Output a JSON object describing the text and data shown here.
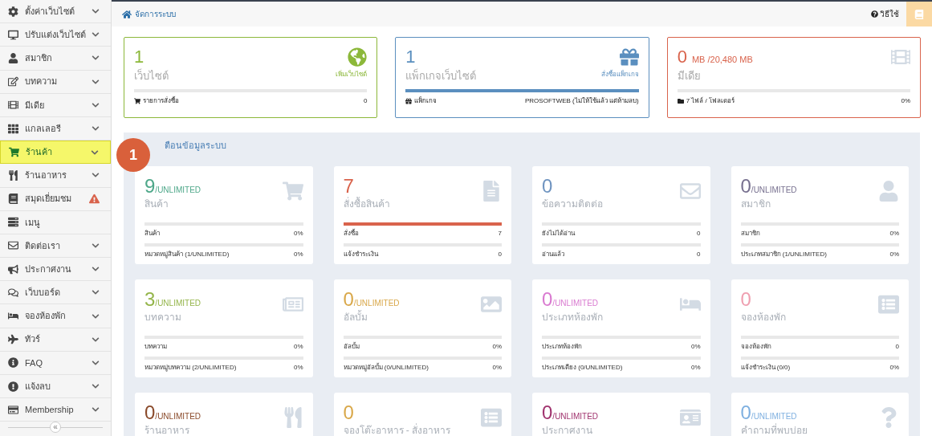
{
  "sidebar": {
    "items": [
      {
        "label": "ตั้งค่าเว็บไซต์",
        "selected": false,
        "kind": "chevron"
      },
      {
        "label": "ปรับแต่งเว็บไซต์",
        "selected": false,
        "kind": "chevron"
      },
      {
        "label": "สมาชิก",
        "selected": false,
        "kind": "chevron"
      },
      {
        "label": "บทความ",
        "selected": false,
        "kind": "chevron"
      },
      {
        "label": "มีเดีย",
        "selected": false,
        "kind": "chevron"
      },
      {
        "label": "แกลเลอรี",
        "selected": false,
        "kind": "chevron"
      },
      {
        "label": "ร้านค้า",
        "selected": true,
        "kind": "chevron"
      },
      {
        "label": "ร้านอาหาร",
        "selected": false,
        "kind": "chevron"
      },
      {
        "label": "สมุดเยี่ยมชม",
        "selected": false,
        "kind": "warning"
      },
      {
        "label": "เมนู",
        "selected": false,
        "kind": "plain"
      },
      {
        "label": "ติดต่อเรา",
        "selected": false,
        "kind": "chevron"
      },
      {
        "label": "ประกาศงาน",
        "selected": false,
        "kind": "chevron"
      },
      {
        "label": "เว็บบอร์ด",
        "selected": false,
        "kind": "chevron"
      },
      {
        "label": "จองห้องพัก",
        "selected": false,
        "kind": "chevron"
      },
      {
        "label": "ทัวร์",
        "selected": false,
        "kind": "chevron"
      },
      {
        "label": "FAQ",
        "selected": false,
        "kind": "chevron"
      },
      {
        "label": "แจ้งลบ",
        "selected": false,
        "kind": "chevron"
      },
      {
        "label": "Membership",
        "selected": false,
        "kind": "chevron"
      }
    ],
    "collapse": "«"
  },
  "header": {
    "breadcrumb": "จัดการระบบ",
    "help": "วิธีใช้"
  },
  "badge": "1",
  "summary_cards": [
    {
      "number": "1",
      "title": "เว็บไซต์",
      "link": "เพิ่มเว็บไซต์",
      "color": "#8cb83a",
      "level": 0,
      "footer_label": "รายการสั่งซื้อ",
      "footer_value": "0"
    },
    {
      "number": "1",
      "title": "แพ็กเกจเว็บไซต์",
      "link": "สั่งซื้อแพ็กเกจ",
      "color": "#5b8fbf",
      "level": 1,
      "footer_label": "แพ็กเกจ",
      "footer_value": "PROSOFTWEB (ไม่ให้ใช้แล้ว แต่ห้ามลบ)"
    },
    {
      "number": "0",
      "unit": "MB  /20,480 MB",
      "title": "มีเดีย",
      "color": "#d9634c",
      "level": 0,
      "footer_label": "7 ไฟล์ / โฟลเดอร์",
      "footer_value": "0%"
    }
  ],
  "section": {
    "title": "ตือนข้อมูลระบบ"
  },
  "stat_cards": [
    {
      "number": "9",
      "unit": "/UNLIMITED",
      "title": "สินค้า",
      "color": "#4fa88a",
      "rows": [
        {
          "label": "สินค้า",
          "value": "0%",
          "level": 0
        },
        {
          "label": "หมวดหมู่สินค้า (1/UNLIMITED)",
          "value": "0%",
          "level": 0
        }
      ]
    },
    {
      "number": "7",
      "title": "สั่งซื้อสินค้า",
      "color": "#d9634c",
      "rows": [
        {
          "label": "สั่งซื้อ",
          "value": "7",
          "level": 1
        },
        {
          "label": "แจ้งชำระเงิน",
          "value": "0",
          "level": 0
        }
      ]
    },
    {
      "number": "0",
      "title": "ข้อความติดต่อ",
      "color": "#6f94c0",
      "rows": [
        {
          "label": "ยังไม่ได้อ่าน",
          "value": "0",
          "level": 0
        },
        {
          "label": "อ่านแล้ว",
          "value": "0",
          "level": 0
        }
      ]
    },
    {
      "number": "0",
      "unit": "/UNLIMITED",
      "title": "สมาชิก",
      "color": "#77708f",
      "rows": [
        {
          "label": "สมาชิก",
          "value": "0%",
          "level": 0
        },
        {
          "label": "ประเภทสมาชิก (1/UNLIMITED)",
          "value": "0%",
          "level": 0
        }
      ]
    },
    {
      "number": "3",
      "unit": "/UNLIMITED",
      "title": "บทความ",
      "color": "#94b54a",
      "rows": [
        {
          "label": "บทความ",
          "value": "0%",
          "level": 0
        },
        {
          "label": "หมวดหมู่บทความ (2/UNLIMITED)",
          "value": "0%",
          "level": 0
        }
      ]
    },
    {
      "number": "0",
      "unit": "/UNLIMITED",
      "title": "อัลบั้ม",
      "color": "#d9a84a",
      "rows": [
        {
          "label": "อัลบั้ม",
          "value": "0%",
          "level": 0
        },
        {
          "label": "หมวดหมู่อัลบั้ม (0/UNLIMITED)",
          "value": "0%",
          "level": 0
        }
      ]
    },
    {
      "number": "0",
      "unit": "/UNLIMITED",
      "title": "ประเภทห้องพัก",
      "color": "#d97ad0",
      "rows": [
        {
          "label": "ประเภทห้องพัก",
          "value": "0%",
          "level": 0
        },
        {
          "label": "ประเภทเตียง (0/UNLIMITED)",
          "value": "0%",
          "level": 0
        }
      ]
    },
    {
      "number": "0",
      "title": "จองห้องพัก",
      "color": "#ef9fb0",
      "rows": [
        {
          "label": "จองห้องพัก",
          "value": "0",
          "level": 0
        },
        {
          "label": "แจ้งชำระเงิน (0/0)",
          "value": "0%",
          "level": 0
        }
      ]
    },
    {
      "number": "0",
      "unit": "/UNLIMITED",
      "title": "ร้านอาหาร",
      "color": "#8a4a2a"
    },
    {
      "number": "0",
      "title": "จองโต๊ะอาหาร - สั่งอาหาร",
      "color": "#d9a84a"
    },
    {
      "number": "0",
      "unit": "/UNLIMITED",
      "title": "ประกาศงาน",
      "color": "#a0336e"
    },
    {
      "number": "0",
      "unit": "/UNLIMITED",
      "title": "คำถามที่พบบ่อย",
      "color": "#7fb0e0"
    }
  ]
}
